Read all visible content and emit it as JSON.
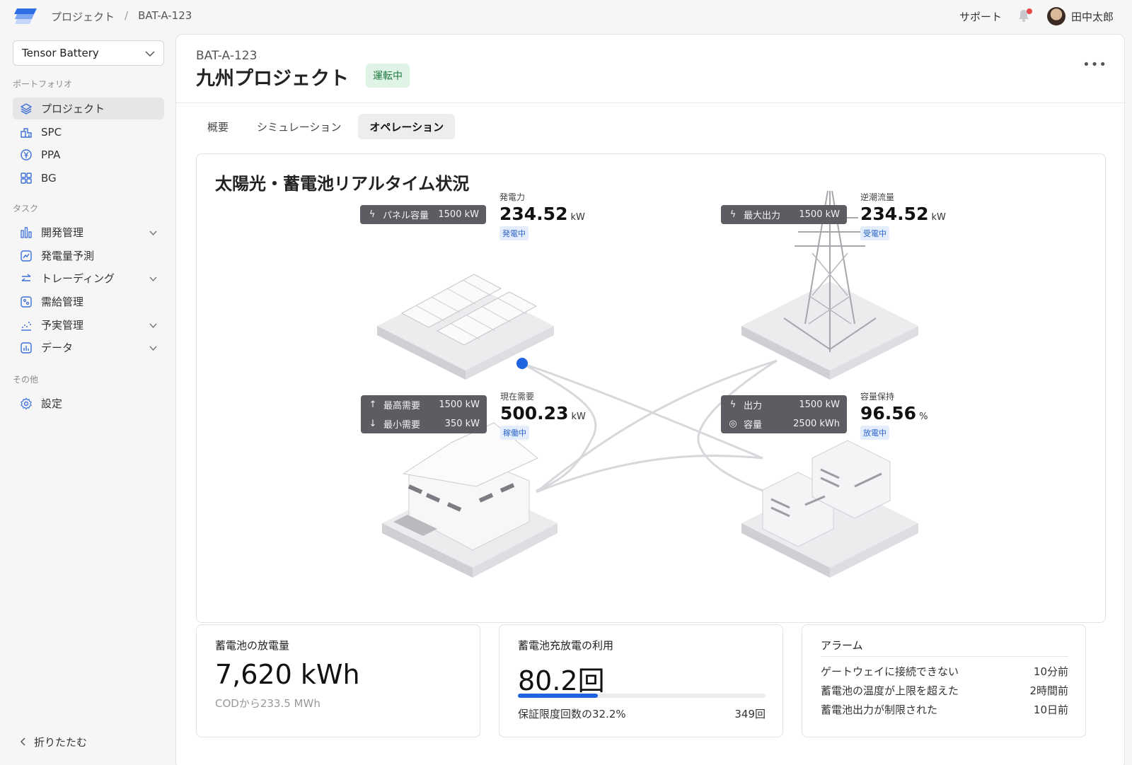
{
  "header": {
    "breadcrumb": [
      "プロジェクト",
      "BAT-A-123"
    ],
    "support_label": "サポート",
    "user_name": "田中太郎"
  },
  "sidebar": {
    "org_select": "Tensor Battery",
    "groups": {
      "portfolio": "ポートフォリオ",
      "tasks": "タスク",
      "other": "その他"
    },
    "items": [
      {
        "label": "プロジェクト",
        "icon": "layers-icon",
        "active": true
      },
      {
        "label": "SPC",
        "icon": "building-icon"
      },
      {
        "label": "PPA",
        "icon": "yen-icon"
      },
      {
        "label": "BG",
        "icon": "grid-icon"
      },
      {
        "label": "開発管理",
        "icon": "bar-chart-icon",
        "expandable": true
      },
      {
        "label": "発電量予測",
        "icon": "trend-icon"
      },
      {
        "label": "トレーディング",
        "icon": "swap-icon",
        "expandable": true
      },
      {
        "label": "需給管理",
        "icon": "balance-icon"
      },
      {
        "label": "予実管理",
        "icon": "scatter-icon",
        "expandable": true
      },
      {
        "label": "データ",
        "icon": "data-chart-icon",
        "expandable": true
      },
      {
        "label": "設定",
        "icon": "gear-icon"
      }
    ],
    "collapse_label": "折りたたむ"
  },
  "project": {
    "code": "BAT-A-123",
    "title": "九州プロジェクト",
    "status": "運転中",
    "status_color": "#1f7a3e"
  },
  "tabs": [
    "概要",
    "シミュレーション",
    "オペレーション"
  ],
  "active_tab": 2,
  "realtime": {
    "title": "太陽光・蓄電池リアルタイム状況",
    "solar": {
      "spec": [
        {
          "key": "パネル容量",
          "value": "1500 kW"
        }
      ],
      "label": "発電力",
      "value": "234.52",
      "unit": "kW",
      "chip": "発電中"
    },
    "grid": {
      "spec": [
        {
          "key": "最大出力",
          "value": "1500 kW"
        }
      ],
      "label": "逆潮流量",
      "value": "234.52",
      "unit": "kW",
      "chip": "受電中"
    },
    "demand": {
      "spec": [
        {
          "key": "最高需要",
          "value": "1500 kW"
        },
        {
          "key": "最小需要",
          "value": "350 kW"
        }
      ],
      "label": "現在需要",
      "value": "500.23",
      "unit": "kW",
      "chip": "稼働中"
    },
    "battery": {
      "spec": [
        {
          "key": "出力",
          "value": "1500 kW"
        },
        {
          "key": "容量",
          "value": "2500 kWh"
        }
      ],
      "label": "容量保持",
      "value": "96.56",
      "unit": "%",
      "chip": "放電中"
    },
    "flow_dot_color": "#1f63e0"
  },
  "cards": {
    "discharge": {
      "title": "蓄電池の放電量",
      "value": "7,620 kWh",
      "sub": "CODから233.5 MWh"
    },
    "cycles": {
      "title": "蓄電池充放電の利用",
      "value": "80.2回",
      "progress": 0.322,
      "progress_label": "保証限度回数の32.2%",
      "limit": "349回"
    },
    "alarms": {
      "title": "アラーム",
      "rows": [
        {
          "text": "ゲートウェイに接続できない",
          "time": "10分前"
        },
        {
          "text": "蓄電池の温度が上限を超えた",
          "time": "2時間前"
        },
        {
          "text": "蓄電池出力が制限された",
          "time": "10日前"
        }
      ]
    }
  },
  "accent_color": "#1f63e0"
}
